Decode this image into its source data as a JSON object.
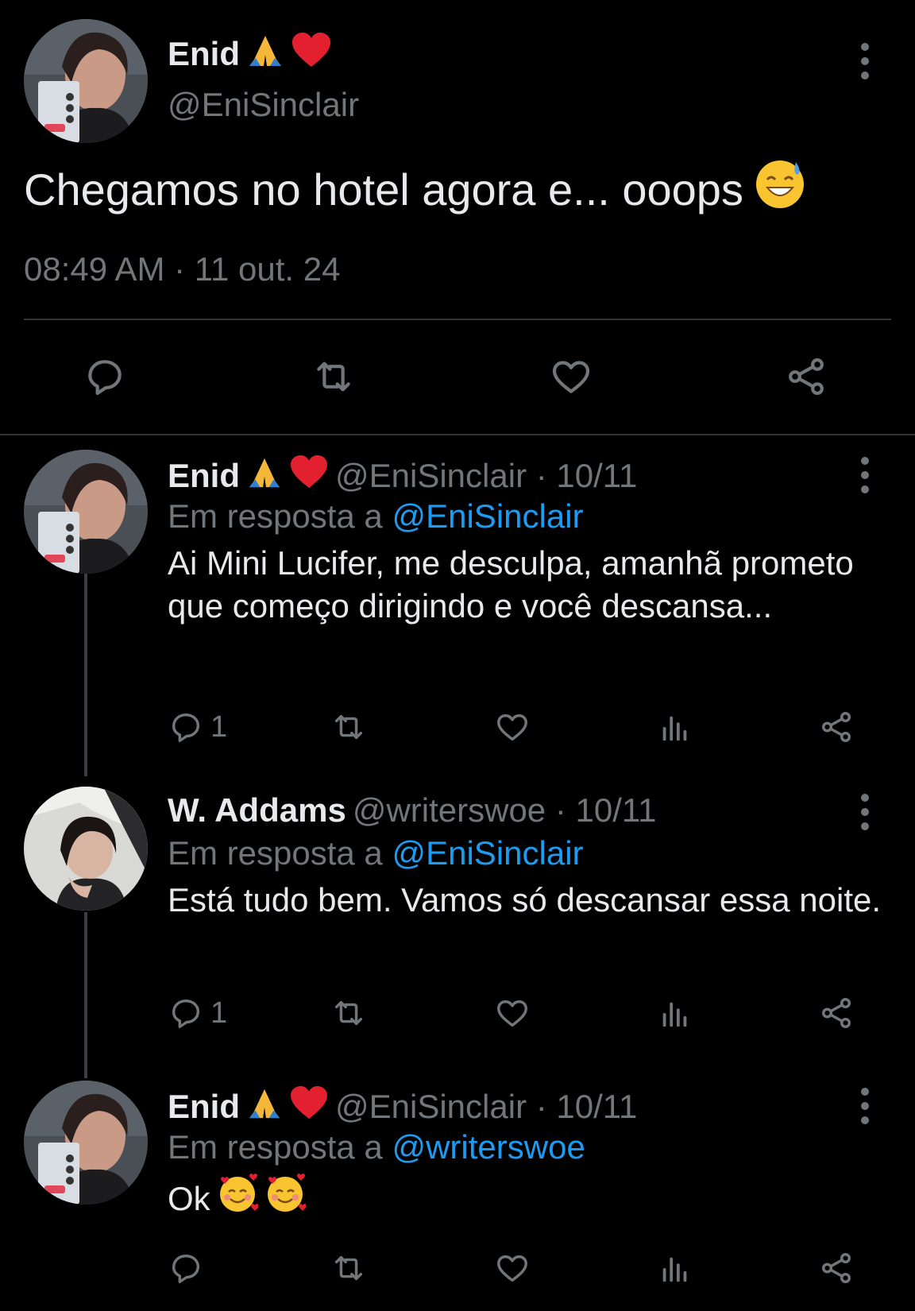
{
  "main_tweet": {
    "author_name": "Enid",
    "author_handle": "@EniSinclair",
    "text": "Chegamos no hotel agora e... ooops",
    "timestamp": "08:49 AM · 11 out. 24"
  },
  "replies": [
    {
      "author_name": "Enid",
      "meta": "@EniSinclair · 10/11",
      "in_reply_prefix": "Em resposta a ",
      "in_reply_to": "@EniSinclair",
      "text": "Ai Mini Lucifer, me desculpa, amanhã prometo que começo dirigindo e você descansa...",
      "reply_count": "1"
    },
    {
      "author_name": "W. Addams",
      "meta": "@writerswoe · 10/11",
      "in_reply_prefix": "Em resposta a ",
      "in_reply_to": "@EniSinclair",
      "text": "Está tudo bem. Vamos só descansar essa noite.",
      "reply_count": "1"
    },
    {
      "author_name": "Enid",
      "meta": "@EniSinclair · 10/11",
      "in_reply_prefix": "Em resposta a ",
      "in_reply_to": "@writerswoe",
      "text": "Ok",
      "reply_count": ""
    }
  ],
  "icons": {
    "reply": "reply-icon",
    "retweet": "retweet-icon",
    "like": "heart-icon",
    "views": "views-icon",
    "share": "share-icon",
    "more": "more-icon"
  },
  "colors": {
    "background": "#000000",
    "text": "#e7e9ea",
    "muted": "#71767b",
    "link": "#1d9bf0",
    "divider": "#2f3336"
  }
}
